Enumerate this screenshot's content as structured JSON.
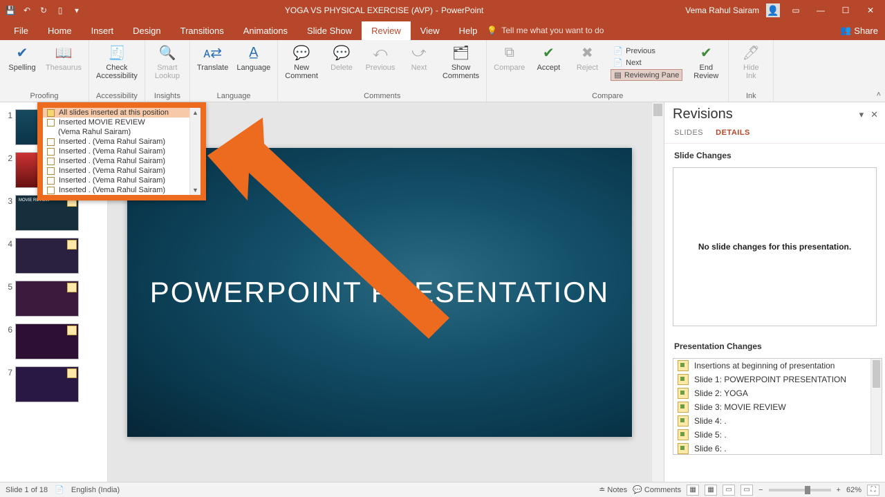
{
  "titlebar": {
    "doc_title": "YOGA VS PHYSICAL EXERCISE (AVP)",
    "app_name": "PowerPoint",
    "user": "Vema Rahul Sairam"
  },
  "menu": {
    "file": "File",
    "home": "Home",
    "insert": "Insert",
    "design": "Design",
    "transitions": "Transitions",
    "animations": "Animations",
    "slideshow": "Slide Show",
    "review": "Review",
    "view": "View",
    "help": "Help",
    "tellme": "Tell me what you want to do",
    "share": "Share"
  },
  "ribbon": {
    "spelling": "Spelling",
    "thesaurus": "Thesaurus",
    "proofing": "Proofing",
    "check_access": "Check\nAccessibility",
    "accessibility": "Accessibility",
    "smart_lookup": "Smart\nLookup",
    "insights": "Insights",
    "translate": "Translate",
    "language": "Language",
    "language_group": "Language",
    "new_comment": "New\nComment",
    "delete": "Delete",
    "previous": "Previous",
    "next": "Next",
    "show_comments": "Show\nComments",
    "comments_group": "Comments",
    "compare": "Compare",
    "accept": "Accept",
    "reject": "Reject",
    "opt_previous": "Previous",
    "opt_next": "Next",
    "opt_reviewing": "Reviewing Pane",
    "end_review": "End\nReview",
    "compare_group": "Compare",
    "hide_ink": "Hide\nInk",
    "ink_group": "Ink"
  },
  "balloon": {
    "header": "All slides inserted at this position",
    "items": [
      "Inserted          MOVIE REVIEW",
      "(Vema Rahul Sairam)",
      "Inserted . (Vema Rahul Sairam)",
      "Inserted . (Vema Rahul Sairam)",
      "Inserted . (Vema Rahul Sairam)",
      "Inserted . (Vema Rahul Sairam)",
      "Inserted . (Vema Rahul Sairam)",
      "Inserted . (Vema Rahul Sairam)"
    ]
  },
  "slide": {
    "title": "POWERPOINT PRESENTATION"
  },
  "thumbs": {
    "t3_label": "MOVIE REVIEW"
  },
  "revisions": {
    "title": "Revisions",
    "tab_slides": "SLIDES",
    "tab_details": "DETAILS",
    "slide_changes": "Slide Changes",
    "no_changes": "No slide changes for this presentation.",
    "pres_changes": "Presentation Changes",
    "items": [
      "Insertions at beginning of presentation",
      "Slide 1: POWERPOINT PRESENTATION",
      "Slide 2: YOGA",
      "Slide 3:           MOVIE REVIEW",
      "Slide 4: .",
      "Slide 5: .",
      "Slide 6: ."
    ]
  },
  "status": {
    "slide_of": "Slide 1 of 18",
    "lang": "English (India)",
    "notes": "Notes",
    "comments": "Comments",
    "zoom": "62%"
  }
}
